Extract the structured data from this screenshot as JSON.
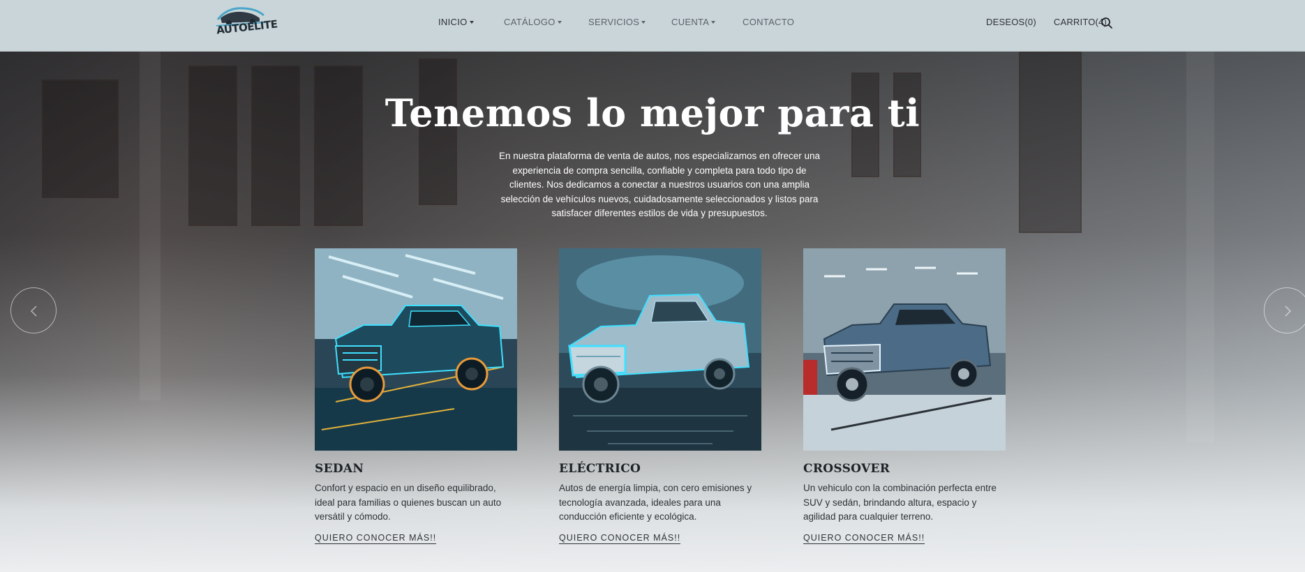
{
  "header": {
    "logo_text": "AUTOELITE",
    "nav": [
      {
        "label": "INICIO",
        "dropdown": true,
        "active": true
      },
      {
        "label": "CATÁLOGO",
        "dropdown": true,
        "active": false
      },
      {
        "label": "SERVICIOS",
        "dropdown": true,
        "active": false
      },
      {
        "label": "CUENTA",
        "dropdown": true,
        "active": false
      },
      {
        "label": "CONTACTO",
        "dropdown": false,
        "active": false
      }
    ],
    "wishlist_label": "DESEOS(0)",
    "cart_label": "CARRITO(4)",
    "search_icon": "search-icon"
  },
  "hero": {
    "title": "Tenemos lo mejor para ti",
    "description": "En nuestra plataforma de venta de autos, nos especializamos en ofrecer una experiencia de compra sencilla, confiable y completa para todo tipo de clientes. Nos dedicamos a conectar a nuestros usuarios con una amplia selección de vehículos nuevos, cuidadosamente seleccionados y listos para satisfacer diferentes estilos de vida y presupuestos."
  },
  "cards": [
    {
      "title": "SEDAN",
      "description": "Confort y espacio en un diseño equilibrado, ideal para familias o quienes buscan un auto versátil y cómodo.",
      "cta": "QUIERO CONOCER MÁS!!"
    },
    {
      "title": "ELÉCTRICO",
      "description": "Autos de energía limpia, con cero emisiones y tecnología avanzada, ideales para una conducción eficiente y ecológica.",
      "cta": "QUIERO CONOCER MÁS!!"
    },
    {
      "title": "CROSSOVER",
      "description": "Un vehiculo con la combinación perfecta entre SUV y sedán, brindando altura, espacio y agilidad para cualquier terreno.",
      "cta": "QUIERO CONOCER MÁS!!"
    }
  ],
  "colors": {
    "header_bg": "#cad5da",
    "text_dark": "#2d3236",
    "neon_blue": "#3fe0ff",
    "neon_orange": "#e89a3a"
  }
}
